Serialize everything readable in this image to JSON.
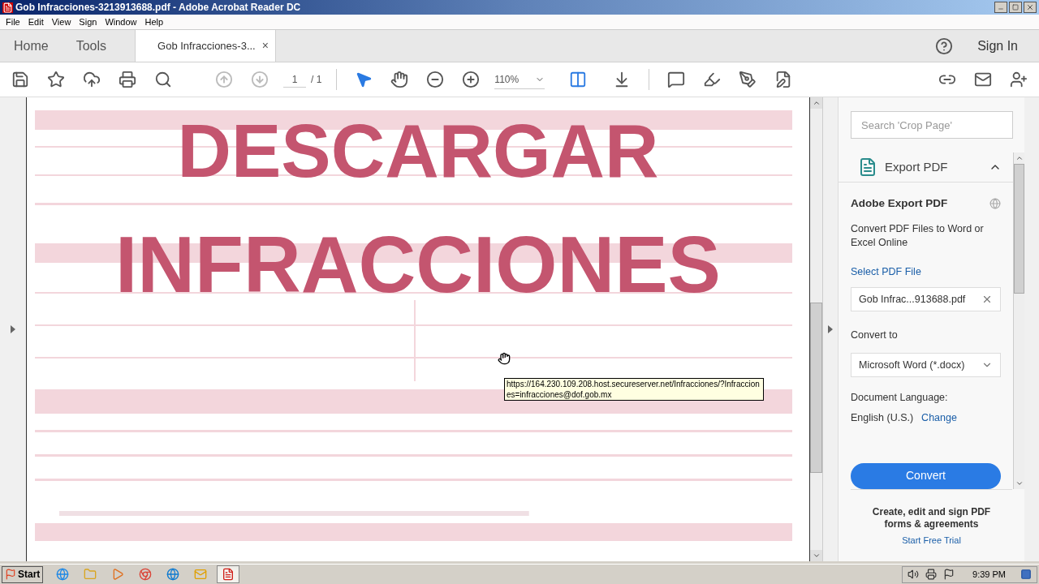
{
  "window": {
    "title": "Gob Infracciones-3213913688.pdf - Adobe Acrobat Reader DC"
  },
  "menu": [
    "File",
    "Edit",
    "View",
    "Sign",
    "Window",
    "Help"
  ],
  "tabs": [
    {
      "label": "Home",
      "selected": false,
      "kind": "nav"
    },
    {
      "label": "Tools",
      "selected": false,
      "kind": "nav"
    },
    {
      "label": "Gob Infracciones-3...",
      "selected": true,
      "kind": "document",
      "close": "×"
    }
  ],
  "sign_in": "Sign In",
  "toolbar": {
    "page": "1",
    "page_total": "/ 1",
    "zoom": "110%"
  },
  "document": {
    "headline": [
      "DESCARGAR",
      "INFRACCIONES"
    ],
    "tooltip": "https://164.230.109.208.host.secureserver.net/Infracciones/?Infracciones=infracciones@dof.gob.mx"
  },
  "panel": {
    "search_placeholder": "Search 'Crop Page'",
    "section": "Export PDF",
    "expanded": true,
    "heading": "Adobe Export PDF",
    "description": "Convert PDF Files to Word or Excel Online",
    "select_link": "Select PDF File",
    "file": "Gob Infrac...913688.pdf",
    "convert_to_label": "Convert to",
    "format": "Microsoft Word (*.docx)",
    "language_label": "Document Language:",
    "language": "English (U.S.)",
    "change_link": "Change",
    "convert_button": "Convert",
    "promo": "Create, edit and sign PDF forms & agreements",
    "trial_link": "Start Free Trial"
  },
  "taskbar": {
    "start": "Start",
    "time": "9:39 PM",
    "apps": [
      {
        "kind": "ie",
        "selected": false
      },
      {
        "kind": "folder",
        "selected": false
      },
      {
        "kind": "media",
        "selected": false
      },
      {
        "kind": "chrome",
        "selected": false
      },
      {
        "kind": "edge",
        "selected": false
      },
      {
        "kind": "outlook",
        "selected": false
      },
      {
        "kind": "acrobat",
        "selected": true
      }
    ]
  }
}
